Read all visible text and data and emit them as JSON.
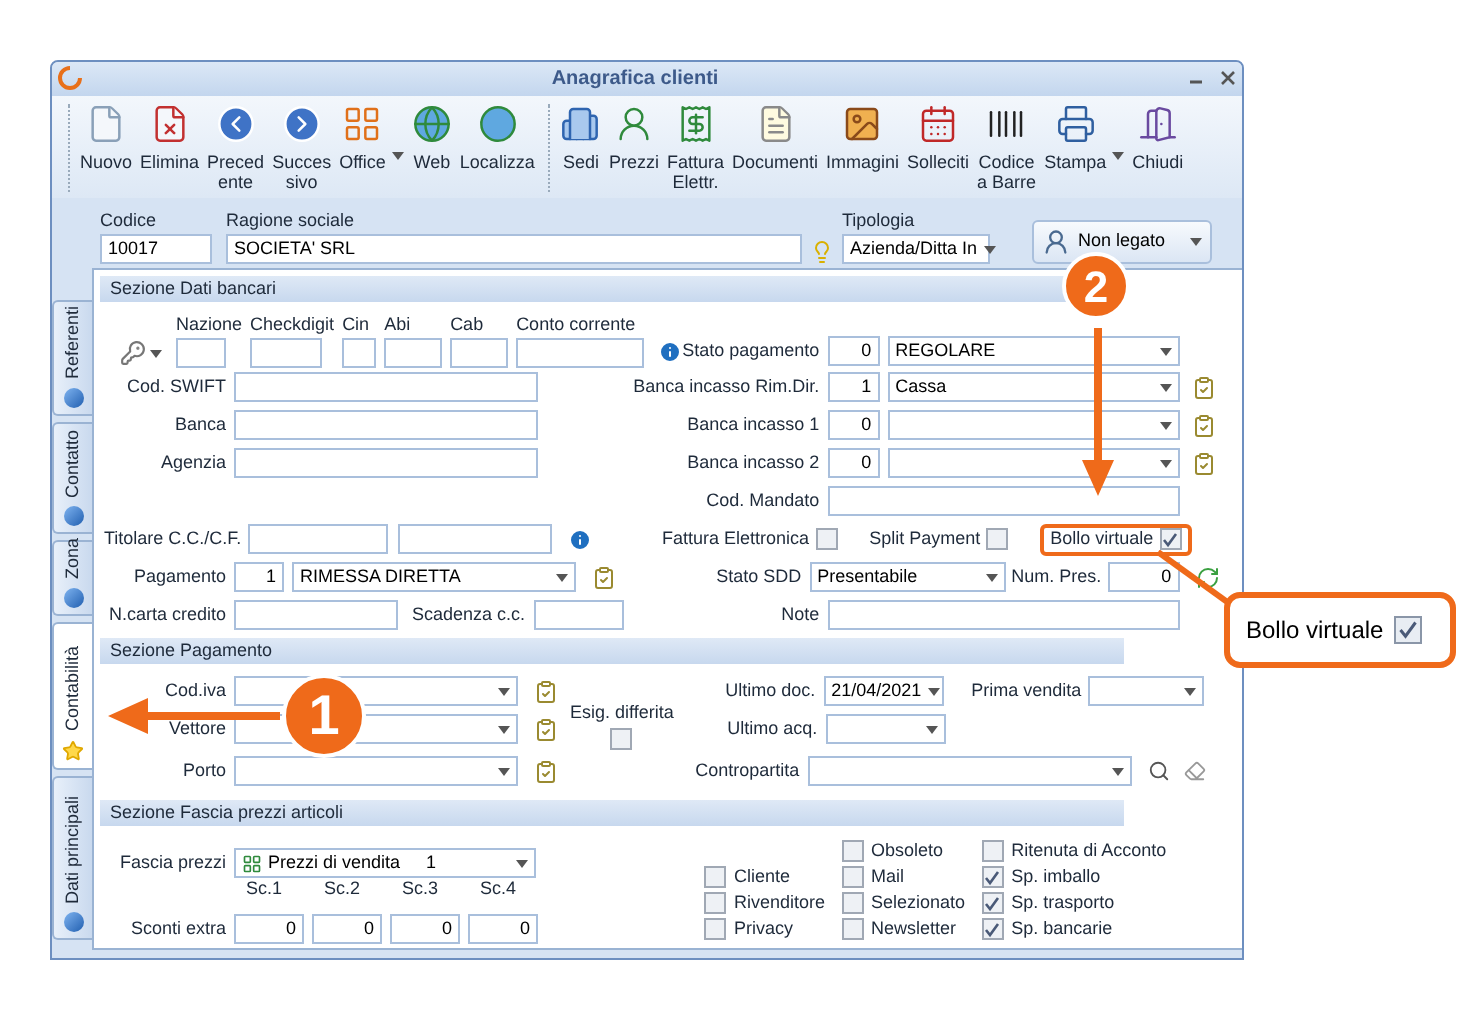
{
  "window": {
    "title": "Anagrafica clienti"
  },
  "toolbar_groups": [
    [
      {
        "label": "Nuovo",
        "kind": "new",
        "dropdown": false
      },
      {
        "label": "Elimina",
        "kind": "delete",
        "dropdown": false
      },
      {
        "label": "Preced\nente",
        "kind": "prev",
        "dropdown": false
      },
      {
        "label": "Succes\nsivo",
        "kind": "next",
        "dropdown": false
      },
      {
        "label": "Office",
        "kind": "office",
        "dropdown": true
      },
      {
        "label": "Web",
        "kind": "web",
        "dropdown": false
      },
      {
        "label": "Localizza",
        "kind": "locate",
        "dropdown": false
      }
    ],
    [
      {
        "label": "Sedi",
        "kind": "sites",
        "dropdown": false
      },
      {
        "label": "Prezzi",
        "kind": "prices",
        "dropdown": false
      },
      {
        "label": "Fattura\nElettr.",
        "kind": "invoice",
        "dropdown": false
      },
      {
        "label": "Documenti",
        "kind": "docs",
        "dropdown": false
      },
      {
        "label": "Immagini",
        "kind": "images",
        "dropdown": false
      },
      {
        "label": "Solleciti",
        "kind": "reminders",
        "dropdown": false
      },
      {
        "label": "Codice\na Barre",
        "kind": "barcode",
        "dropdown": false
      },
      {
        "label": "Stampa",
        "kind": "print",
        "dropdown": true
      },
      {
        "label": "Chiudi",
        "kind": "close",
        "dropdown": false
      }
    ]
  ],
  "header": {
    "codice": {
      "label": "Codice",
      "value": "10017"
    },
    "ragione_sociale": {
      "label": "Ragione sociale",
      "value": "SOCIETA' SRL"
    },
    "tipologia": {
      "label": "Tipologia",
      "value": "Azienda/Ditta In"
    },
    "link_button": "Non legato"
  },
  "side_tabs": [
    {
      "label": "Referenti",
      "selected": false
    },
    {
      "label": "Contatto",
      "selected": false
    },
    {
      "label": "Zona",
      "selected": false
    },
    {
      "label": "Contabilità",
      "selected": true
    },
    {
      "label": "Dati principali",
      "selected": false
    }
  ],
  "bank": {
    "title": "Sezione Dati bancari",
    "iban_columns": [
      "Nazione",
      "Checkdigit",
      "Cin",
      "Abi",
      "Cab",
      "Conto corrente"
    ],
    "left_fields": [
      {
        "label": "Cod. SWIFT"
      },
      {
        "label": "Banca"
      },
      {
        "label": "Agenzia"
      }
    ],
    "titolare": {
      "label": "Titolare C.C./C.F."
    },
    "pagamento": {
      "label": "Pagamento",
      "code": "1",
      "value": "RIMESSA DIRETTA"
    },
    "carta": {
      "label": "N.carta credito"
    },
    "scadenza": {
      "label": "Scadenza c.c."
    },
    "stato_pagamento": {
      "label": "Stato pagamento",
      "code": "0",
      "value": "REGOLARE"
    },
    "banche_incasso": [
      {
        "label": "Banca incasso Rim.Dir.",
        "code": "1",
        "value": "Cassa"
      },
      {
        "label": "Banca incasso 1",
        "code": "0"
      },
      {
        "label": "Banca incasso 2",
        "code": "0"
      }
    ],
    "cod_mandato": {
      "label": "Cod. Mandato"
    },
    "flags": [
      {
        "label": "Fattura Elettronica",
        "checked": false,
        "kind": "plain"
      },
      {
        "label": "Split Payment",
        "checked": false,
        "kind": "plain"
      },
      {
        "label": "Bollo virtuale",
        "checked": true,
        "kind": "annotated"
      }
    ],
    "stato_sdd": {
      "label": "Stato SDD",
      "value": "Presentabile"
    },
    "num_pres": {
      "label": "Num. Pres.",
      "value": "0"
    },
    "note": {
      "label": "Note"
    }
  },
  "payment": {
    "title": "Sezione Pagamento",
    "selects": [
      {
        "label": "Cod.iva"
      },
      {
        "label": "Vettore"
      },
      {
        "label": "Porto"
      }
    ],
    "esig": {
      "label": "Esig. differita",
      "checked": false
    },
    "ultimo_doc": {
      "label": "Ultimo doc.",
      "value": "21/04/2021"
    },
    "prima_vendita": {
      "label": "Prima vendita"
    },
    "ultimo_acq": {
      "label": "Ultimo acq."
    },
    "contropartita": {
      "label": "Contropartita"
    }
  },
  "prices": {
    "title": "Sezione Fascia prezzi articoli",
    "fascia": {
      "label": "Fascia prezzi",
      "value": "Prezzi di vendita",
      "number": "1"
    },
    "sconti_label": "Sconti extra",
    "sconti": [
      {
        "label": "Sc.1",
        "value": "0"
      },
      {
        "label": "Sc.2",
        "value": "0"
      },
      {
        "label": "Sc.3",
        "value": "0"
      },
      {
        "label": "Sc.4",
        "value": "0"
      }
    ],
    "flag_columns": [
      [
        {
          "label": "Cliente",
          "checked": false
        },
        {
          "label": "Rivenditore",
          "checked": false
        },
        {
          "label": "Privacy",
          "checked": false
        }
      ],
      [
        {
          "label": "Obsoleto",
          "checked": false
        },
        {
          "label": "Mail",
          "checked": false
        },
        {
          "label": "Selezionato",
          "checked": false
        },
        {
          "label": "Newsletter",
          "checked": false
        }
      ],
      [
        {
          "label": "Ritenuta di Acconto",
          "checked": false
        },
        {
          "label": "Sp. imballo",
          "checked": true
        },
        {
          "label": "Sp. trasporto",
          "checked": true
        },
        {
          "label": "Sp. bancarie",
          "checked": true
        }
      ]
    ]
  },
  "annotations": {
    "steps": [
      "1",
      "2"
    ],
    "zoom_callout": {
      "label": "Bollo virtuale",
      "checked": true
    }
  }
}
